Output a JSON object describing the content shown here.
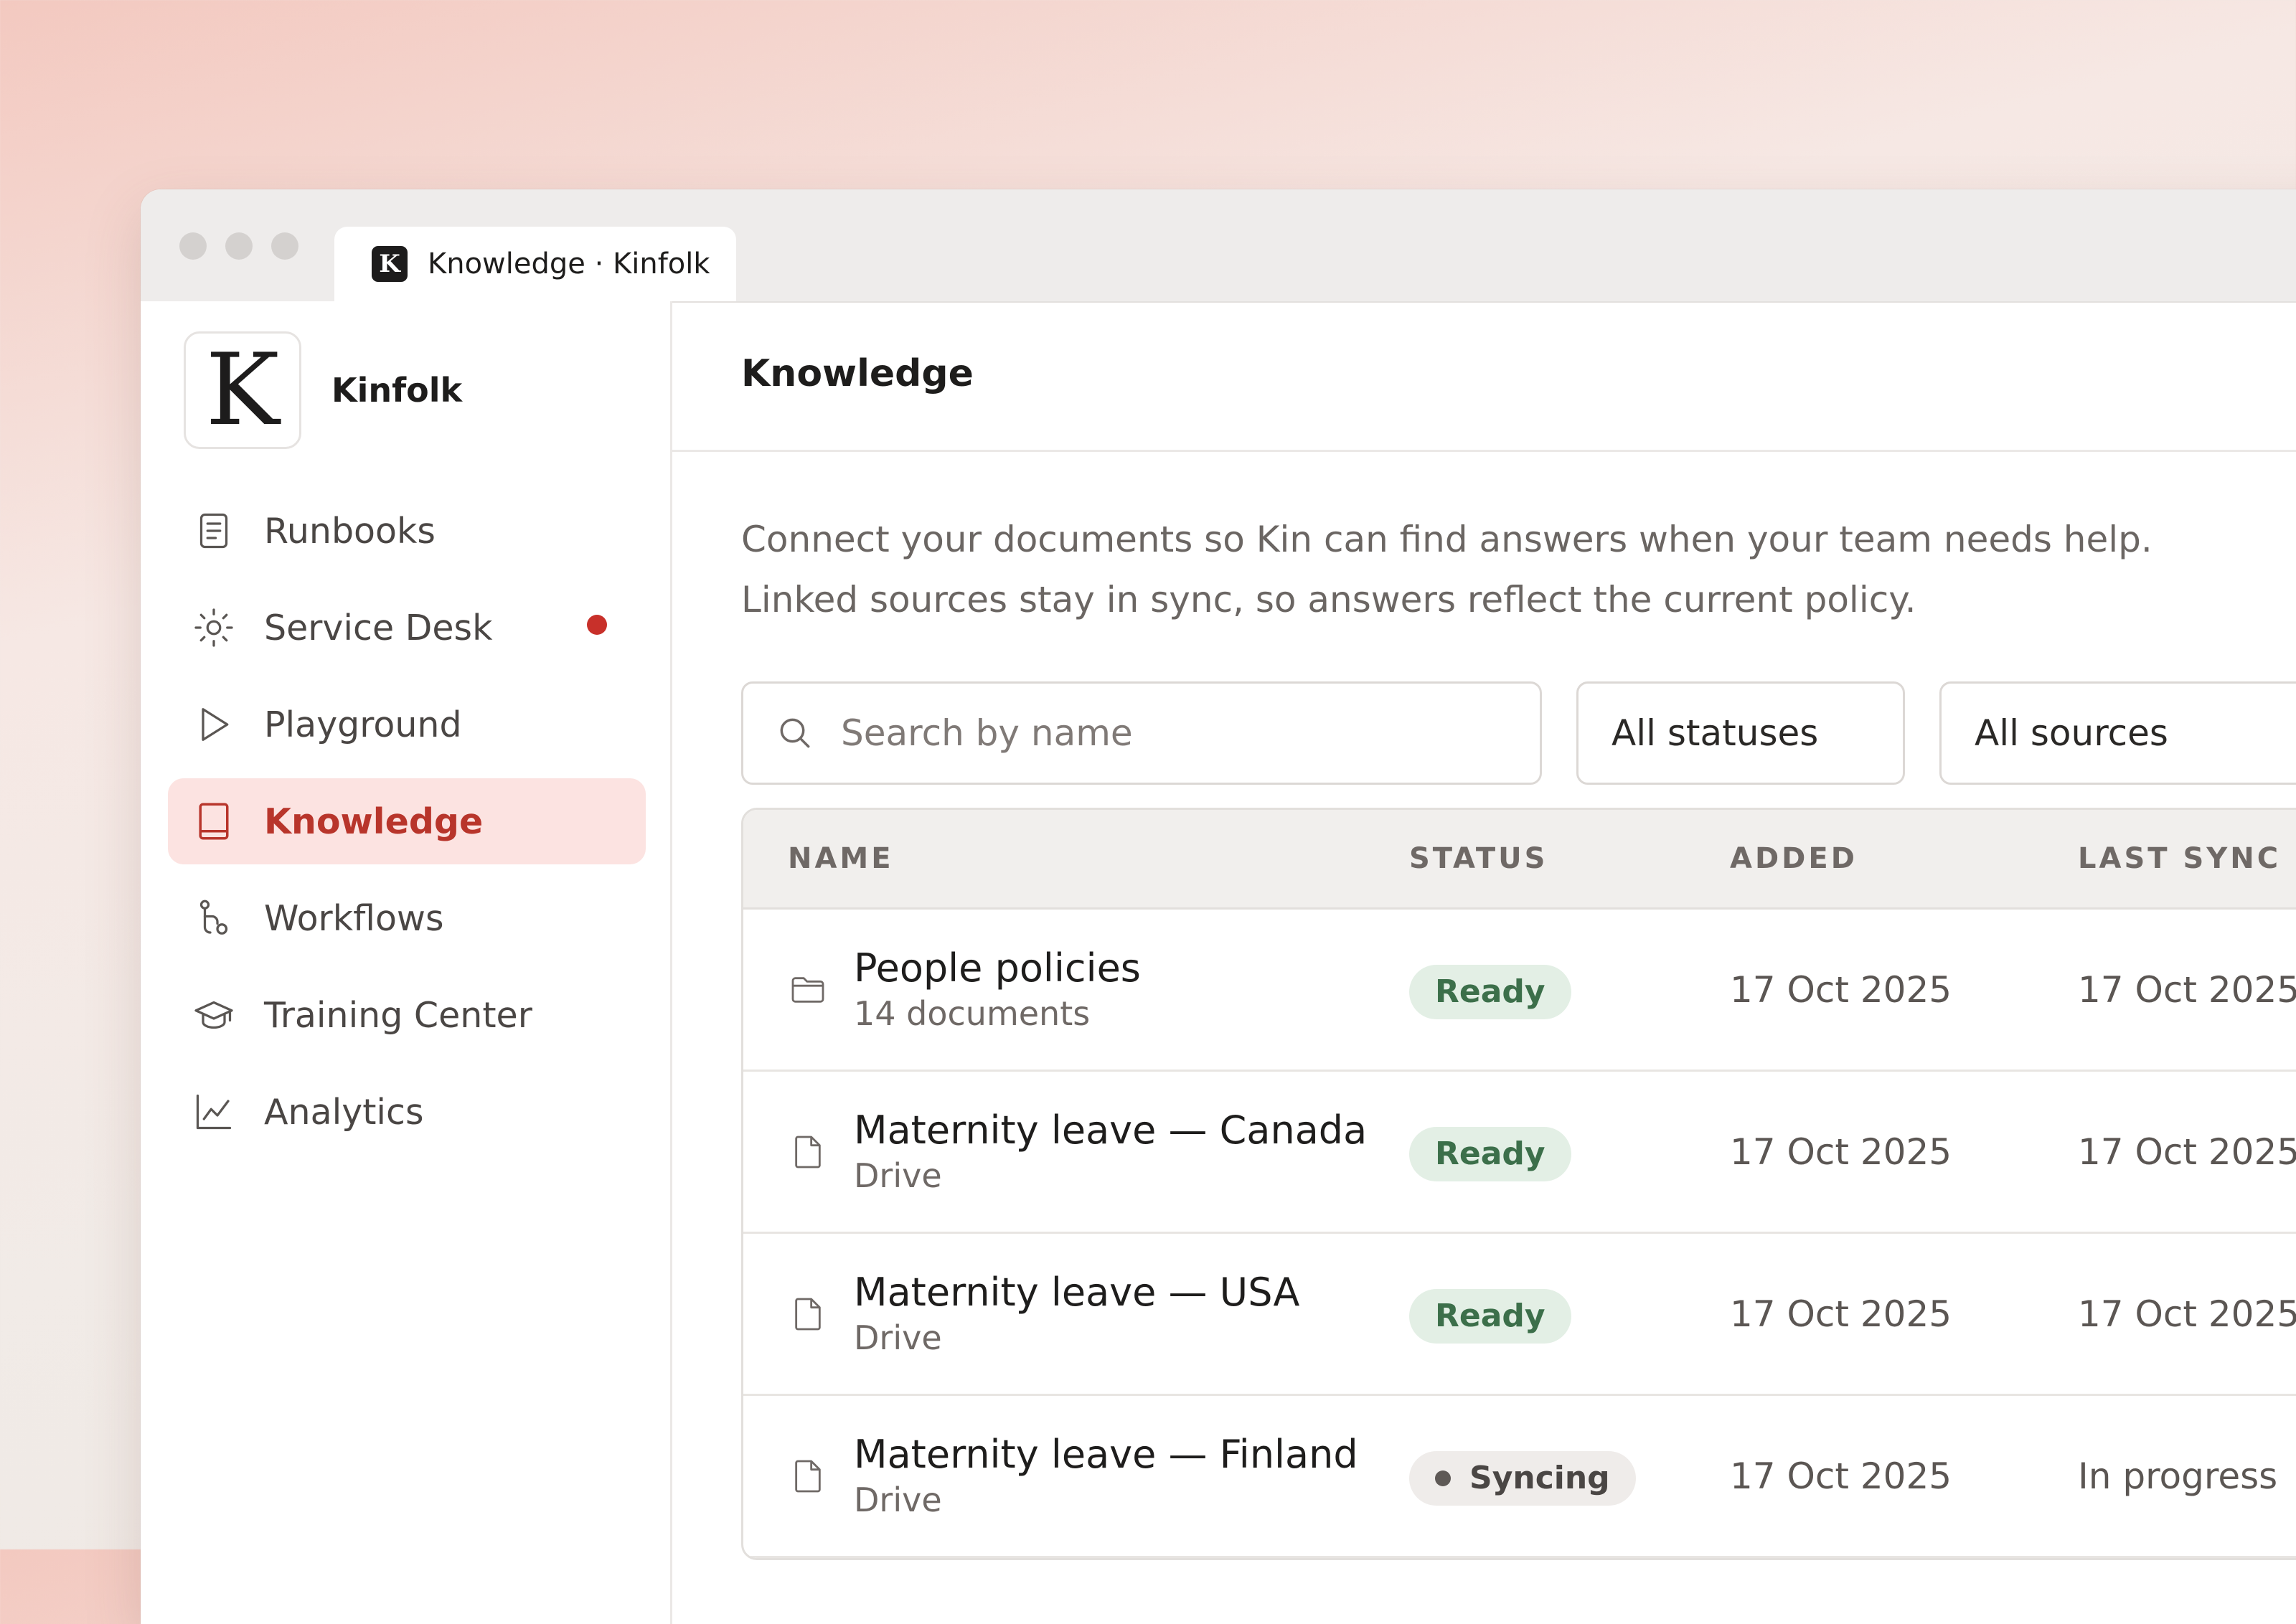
{
  "browser": {
    "tab_title": "Knowledge · Kinfolk",
    "favicon_letter": "K"
  },
  "sidebar": {
    "brand_logo_letter": "K",
    "brand_name": "Kinfolk",
    "items": [
      {
        "label": "Runbooks",
        "icon": "document-icon"
      },
      {
        "label": "Service Desk",
        "icon": "sun-icon",
        "has_notification": true
      },
      {
        "label": "Playground",
        "icon": "play-icon"
      },
      {
        "label": "Knowledge",
        "icon": "book-icon",
        "active": true
      },
      {
        "label": "Workflows",
        "icon": "workflow-icon"
      },
      {
        "label": "Training Center",
        "icon": "graduation-cap-icon"
      },
      {
        "label": "Analytics",
        "icon": "line-chart-icon"
      }
    ]
  },
  "main": {
    "title": "Knowledge",
    "description": "Connect your documents so Kin can find answers when your team needs help. Linked sources stay in sync, so answers reflect the current policy.",
    "search": {
      "placeholder": "Search by name",
      "value": ""
    },
    "status_filter": "All statuses",
    "source_filter": "All sources",
    "table": {
      "columns": [
        "NAME",
        "STATUS",
        "ADDED",
        "LAST SYNC"
      ],
      "rows": [
        {
          "name": "People policies",
          "sub": "14 documents",
          "icon": "folder-icon",
          "status": "Ready",
          "added": "17 Oct 2025",
          "last_sync": "17 Oct 2025"
        },
        {
          "name": "Maternity leave — Canada",
          "sub": "Drive",
          "icon": "file-icon",
          "status": "Ready",
          "added": "17 Oct 2025",
          "last_sync": "17 Oct 2025"
        },
        {
          "name": "Maternity leave — USA",
          "sub": "Drive",
          "icon": "file-icon",
          "status": "Ready",
          "added": "17 Oct 2025",
          "last_sync": "17 Oct 2025"
        },
        {
          "name": "Maternity leave — Finland",
          "sub": "Drive",
          "icon": "file-icon",
          "status": "Syncing",
          "added": "17 Oct 2025",
          "last_sync": "In progress"
        }
      ]
    }
  },
  "colors": {
    "accent": "#b8352b",
    "active_bg": "#fce3e1",
    "ready_bg": "#e3efe5",
    "ready_text": "#3c6f4a",
    "notification": "#c8302a"
  }
}
